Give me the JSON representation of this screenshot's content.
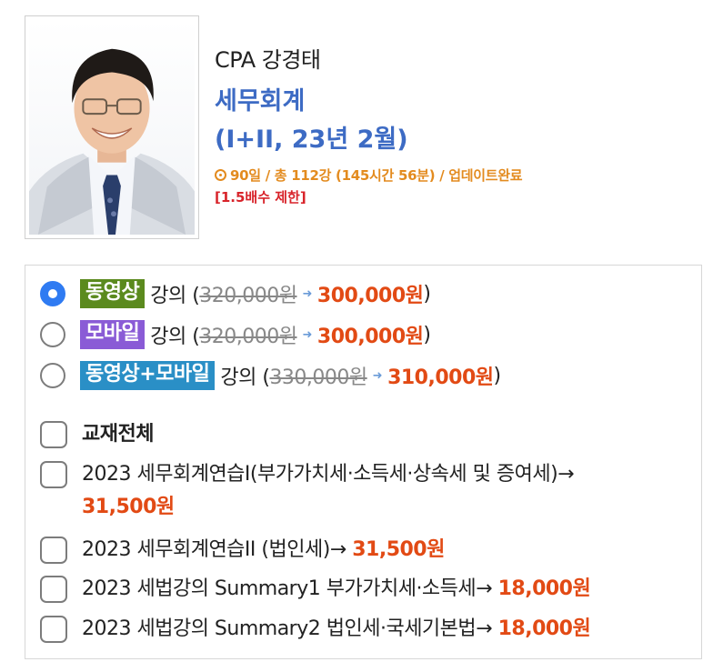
{
  "course": {
    "instructor": "CPA 강경태",
    "subject": "세무회계",
    "edition": "(I+II, 23년 2월)",
    "meta": "90일 / 총 112강 (145시간 56분) / 업데이트완료",
    "limit": "[1.5배수 제한]"
  },
  "options": [
    {
      "badge": "동영상",
      "badge_color": "#5b8a1e",
      "label": "강의 (",
      "old_price": "320,000원",
      "price": "300,000원",
      "close": ")",
      "selected": true
    },
    {
      "badge": "모바일",
      "badge_color": "#8a5bd6",
      "label": "강의 (",
      "old_price": "320,000원",
      "price": "300,000원",
      "close": ")",
      "selected": false
    },
    {
      "badge": "동영상+모바일",
      "badge_color": "#2a8fc6",
      "label": "강의 (",
      "old_price": "330,000원",
      "price": "310,000원",
      "close": ")",
      "selected": false
    }
  ],
  "books": {
    "all_label": "교재전체",
    "items": [
      {
        "name": "2023 세무회계연습I(부가가치세·소득세·상속세 및 증여세)→",
        "price": "31,500원"
      },
      {
        "name": "2023 세무회계연습II (법인세)→",
        "price": "31,500원"
      },
      {
        "name": "2023 세법강의 Summary1 부가가치세·소득세→",
        "price": "18,000원"
      },
      {
        "name": "2023 세법강의 Summary2 법인세·국세기본법→",
        "price": "18,000원"
      }
    ]
  },
  "colors": {
    "accent_blue": "#3d6bc4",
    "meta_orange": "#e38b1f",
    "limit_red": "#d8232a",
    "price_red": "#e24a14",
    "radio_selected": "#2f7bf2"
  },
  "icons": {
    "meta": "clock-icon",
    "price_arrow": "arrow-right-icon"
  }
}
